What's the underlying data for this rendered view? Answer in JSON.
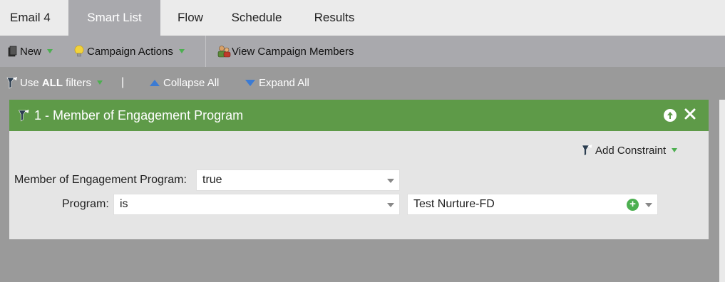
{
  "tabs": [
    {
      "label": "Email 4"
    },
    {
      "label": "Smart List"
    },
    {
      "label": "Flow"
    },
    {
      "label": "Schedule"
    },
    {
      "label": "Results"
    }
  ],
  "toolbar": {
    "new_label": "New",
    "campaign_actions_label": "Campaign Actions",
    "view_members_label": "View Campaign Members"
  },
  "filterbar": {
    "use_prefix": "Use ",
    "use_bold": "ALL",
    "use_suffix": " filters",
    "pipe": "|",
    "collapse_label": "Collapse All",
    "expand_label": "Expand All"
  },
  "filter": {
    "title": "1 - Member of Engagement Program",
    "add_constraint_label": "Add Constraint",
    "rows": [
      {
        "label": "Member of Engagement Program:",
        "value": "true"
      },
      {
        "label": "Program:",
        "operator": "is",
        "value": "Test Nurture-FD"
      }
    ]
  },
  "colors": {
    "panel_header": "#5e9a48",
    "active_tab": "#a9a9ad",
    "accent_arrow": "#4caf50",
    "link_triangle": "#3b7bd4"
  }
}
